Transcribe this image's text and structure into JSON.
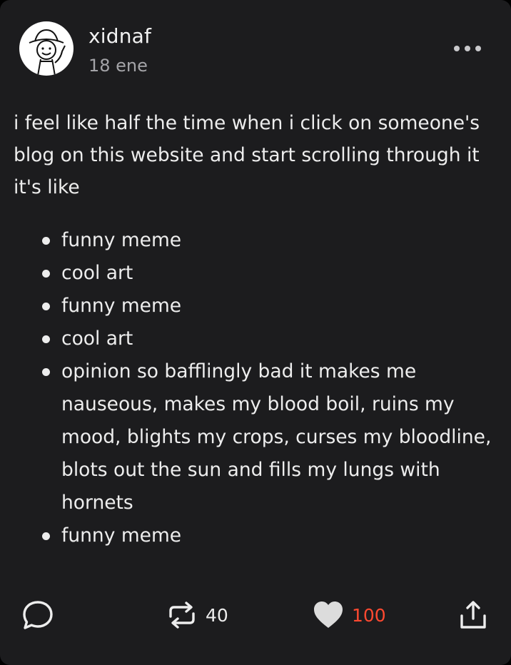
{
  "post": {
    "author": "xidnaf",
    "date": "18 ene",
    "body": "i feel like half the time when i click on someone's blog on this website and start scrolling through it it's like",
    "list_items": [
      "funny meme",
      "cool art",
      "funny meme",
      "cool art",
      "opinion so bafflingly bad it makes me nauseous, makes my blood boil, ruins my mood, blights my crops, curses my bloodline, blots out the sun and fills my lungs with hornets",
      "funny meme"
    ]
  },
  "actions": {
    "reply_icon": "speech-bubble-icon",
    "reblog_icon": "reblog-icon",
    "reblog_count": "40",
    "like_icon": "heart-icon",
    "like_count": "100",
    "share_icon": "share-icon",
    "more_icon": "ellipsis-icon"
  },
  "colors": {
    "background": "#1c1c1e",
    "text": "#ededed",
    "muted": "#a4a4a8",
    "like_count": "#ff4930"
  }
}
